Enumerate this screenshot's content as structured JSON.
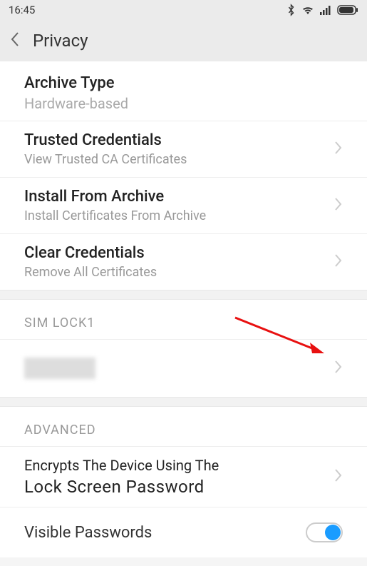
{
  "status": {
    "time": "16:45"
  },
  "header": {
    "title": "Privacy"
  },
  "items": {
    "archive_type": {
      "title": "Archive Type",
      "subtitle": "Hardware-based"
    },
    "trusted_credentials": {
      "title": "Trusted Credentials",
      "subtitle": "View Trusted CA Certificates"
    },
    "install_from_archive": {
      "title": "Install From Archive",
      "subtitle": "Install Certificates From Archive"
    },
    "clear_credentials": {
      "title": "Clear Credentials",
      "subtitle": "Remove All Certificates"
    },
    "encrypt": {
      "title": "Encrypts The Device Using The",
      "title2": "Lock Screen Password"
    },
    "visible_passwords": {
      "title": "Visible Passwords"
    }
  },
  "sections": {
    "sim_lock": "SIM LOCK1",
    "advanced": "ADVANCED"
  }
}
